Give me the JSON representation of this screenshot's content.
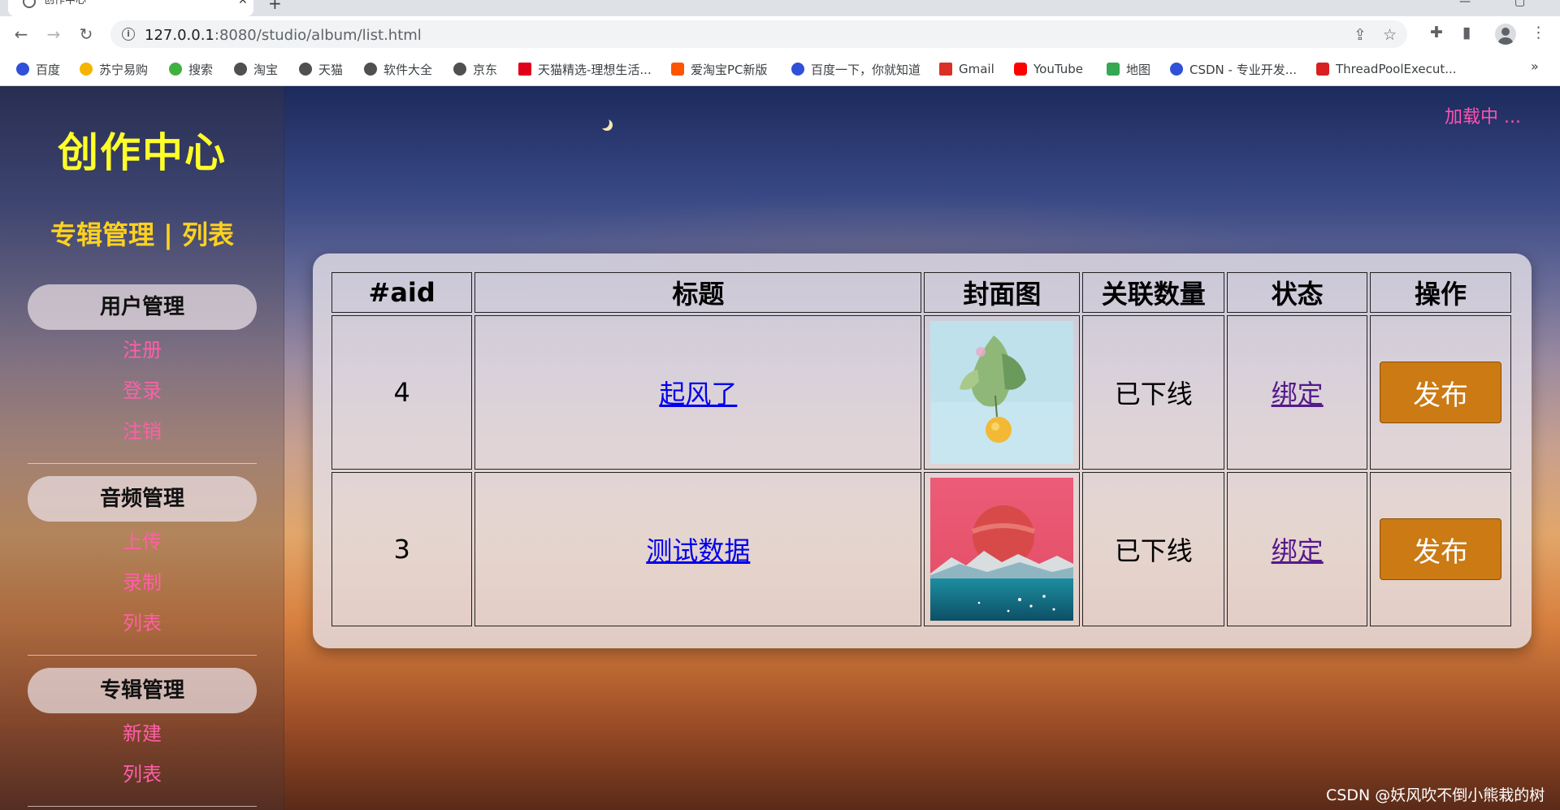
{
  "browser": {
    "tab_title": "创作中心",
    "url_host": "127.0.0.1",
    "url_path": ":8080/studio/album/list.html",
    "bookmarks": [
      {
        "label": "百度",
        "color": "#3050d8"
      },
      {
        "label": "苏宁易购",
        "color": "#f5b400"
      },
      {
        "label": "搜索",
        "color": "#40b040"
      },
      {
        "label": "淘宝",
        "color": "#505050"
      },
      {
        "label": "天猫",
        "color": "#505050"
      },
      {
        "label": "软件大全",
        "color": "#505050"
      },
      {
        "label": "京东",
        "color": "#505050"
      },
      {
        "label": "天猫精选-理想生活...",
        "color": "#e0001a"
      },
      {
        "label": "爱淘宝PC新版",
        "color": "#ff5500"
      },
      {
        "label": "百度一下，你就知道",
        "color": "#3050d8"
      },
      {
        "label": "Gmail",
        "color": "#d93025"
      },
      {
        "label": "YouTube",
        "color": "#ff0000"
      },
      {
        "label": "地图",
        "color": "#34a853"
      },
      {
        "label": "CSDN - 专业开发...",
        "color": "#3050d8"
      },
      {
        "label": "ThreadPoolExecut...",
        "color": "#d82020"
      }
    ],
    "more": "»"
  },
  "sidebar": {
    "brand": "创作中心",
    "subtitle": "专辑管理 | 列表",
    "groups": [
      {
        "title": "用户管理",
        "items": [
          "注册",
          "登录",
          "注销"
        ]
      },
      {
        "title": "音频管理",
        "items": [
          "上传",
          "录制",
          "列表"
        ]
      },
      {
        "title": "专辑管理",
        "items": [
          "新建",
          "列表"
        ]
      }
    ]
  },
  "header": {
    "loading": "加载中 ..."
  },
  "table": {
    "headers": [
      "#aid",
      "标题",
      "封面图",
      "关联数量",
      "状态",
      "操作"
    ],
    "rows": [
      {
        "aid": "4",
        "title": "起风了",
        "count": "已下线",
        "status": "绑定",
        "action": "发布"
      },
      {
        "aid": "3",
        "title": "测试数据",
        "count": "已下线",
        "status": "绑定",
        "action": "发布"
      }
    ]
  },
  "colors": {
    "brand": "#ffff2a",
    "subtitle": "#ffd21e",
    "link_pink": "#ff5fa8",
    "publish": "#cb7a14"
  },
  "watermark": "CSDN @妖风吹不倒小熊栽的树"
}
